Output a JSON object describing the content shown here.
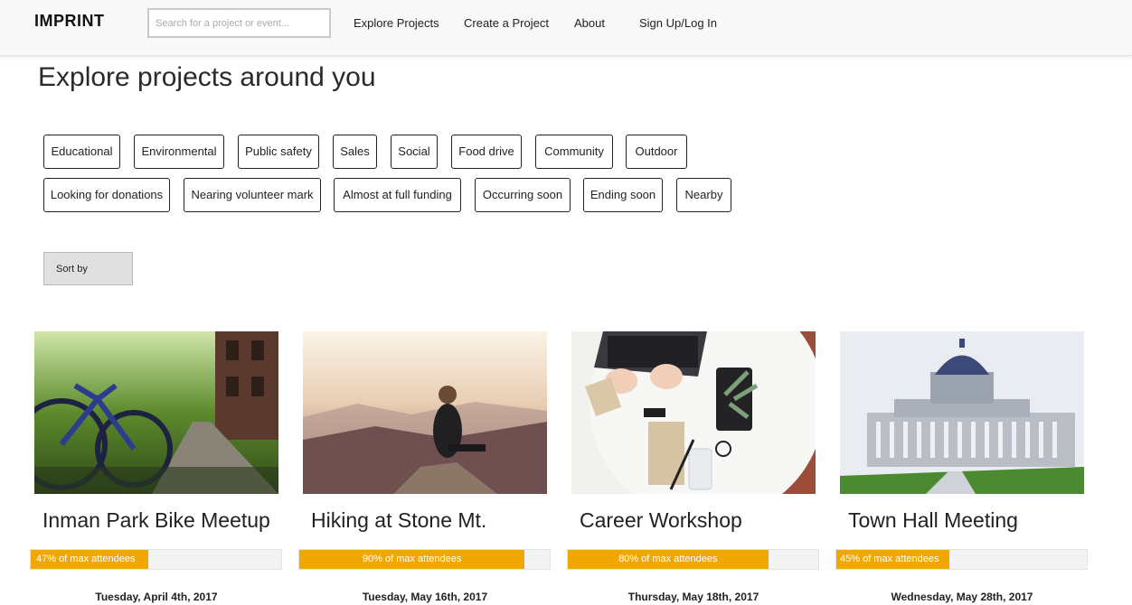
{
  "header": {
    "brand": "IMPRINT",
    "search_placeholder": "Search for a project or event...",
    "nav": [
      "Explore Projects",
      "Create a Project",
      "About",
      "Sign Up/Log In"
    ]
  },
  "page_title": "Explore projects around you",
  "filters": {
    "row1": [
      "Educational",
      "Environmental",
      "Public safety",
      "Sales",
      "Social",
      "Food drive",
      "Community",
      "Outdoor"
    ],
    "row2": [
      "Looking for donations",
      "Nearing volunteer mark",
      "Almost at full funding",
      "Occurring soon",
      "Ending soon",
      "Nearby"
    ]
  },
  "sort_label": "Sort by",
  "colors": {
    "accent": "#f0a800",
    "nav_bg": "#f8f8f8",
    "sort_bg": "#e0e0e0"
  },
  "projects": [
    {
      "title": "Inman Park Bike Meetup",
      "progress_label": "47% of max attendees",
      "progress_percent": 47,
      "date": "Tuesday, April 4th, 2017",
      "image": "bicycles-on-path-photo"
    },
    {
      "title": "Hiking at Stone Mt.",
      "progress_label": "90% of max attendees",
      "progress_percent": 90,
      "date": "Tuesday, May 16th, 2017",
      "image": "hiker-on-mountain-photo"
    },
    {
      "title": "Career Workshop",
      "progress_label": "80% of max attendees",
      "progress_percent": 80,
      "date": "Thursday, May 18th, 2017",
      "image": "laptop-desk-photo"
    },
    {
      "title": "Town Hall Meeting",
      "progress_label": "45% of max attendees",
      "progress_percent": 45,
      "date": "Wednesday, May 28th, 2017",
      "image": "capitol-building-photo"
    }
  ]
}
